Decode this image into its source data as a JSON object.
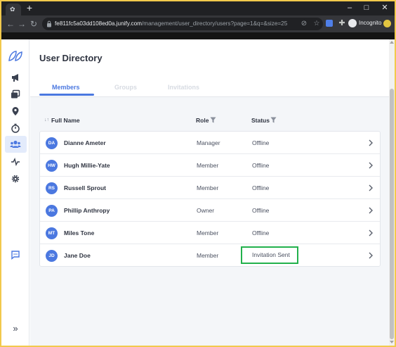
{
  "browser": {
    "url_host": "fe811fc5a03dd108ed0a.junify.com",
    "url_path": "/management/user_directory/users?page=1&q=&size=25",
    "incognito_label": "Incognito",
    "new_tab_symbol": "+"
  },
  "sidebar": {
    "items": [
      {
        "icon": "leaf-logo-icon"
      },
      {
        "icon": "megaphone-icon"
      },
      {
        "icon": "cards-icon"
      },
      {
        "icon": "location-pin-icon"
      },
      {
        "icon": "stopwatch-icon"
      },
      {
        "icon": "users-icon",
        "active": true
      },
      {
        "icon": "activity-icon"
      },
      {
        "icon": "gear-icon"
      },
      {
        "icon": "chat-icon"
      },
      {
        "icon": "expand-icon"
      }
    ],
    "expand_symbol": "»"
  },
  "page": {
    "title": "User Directory",
    "tabs": [
      {
        "label": "Members",
        "active": true
      },
      {
        "label": "Groups",
        "active": false
      },
      {
        "label": "Invitations",
        "active": false
      }
    ]
  },
  "table": {
    "columns": {
      "name": "Full Name",
      "role": "Role",
      "status": "Status"
    },
    "sort_symbol": "↓↑",
    "rows": [
      {
        "initials": "DA",
        "name": "Dianne Ameter",
        "role": "Manager",
        "status": "Offline"
      },
      {
        "initials": "HW",
        "name": "Hugh Millie-Yate",
        "role": "Member",
        "status": "Offline"
      },
      {
        "initials": "RS",
        "name": "Russell Sprout",
        "role": "Member",
        "status": "Offline"
      },
      {
        "initials": "PA",
        "name": "Phillip Anthropy",
        "role": "Owner",
        "status": "Offline"
      },
      {
        "initials": "MT",
        "name": "Miles Tone",
        "role": "Member",
        "status": "Offline"
      },
      {
        "initials": "JD",
        "name": "Jane Doe",
        "role": "Member",
        "status": "Invitation Sent",
        "highlighted": true
      }
    ]
  },
  "colors": {
    "accent": "#4b78e0",
    "highlight_border": "#22b14c",
    "frame": "#f2c94c"
  }
}
